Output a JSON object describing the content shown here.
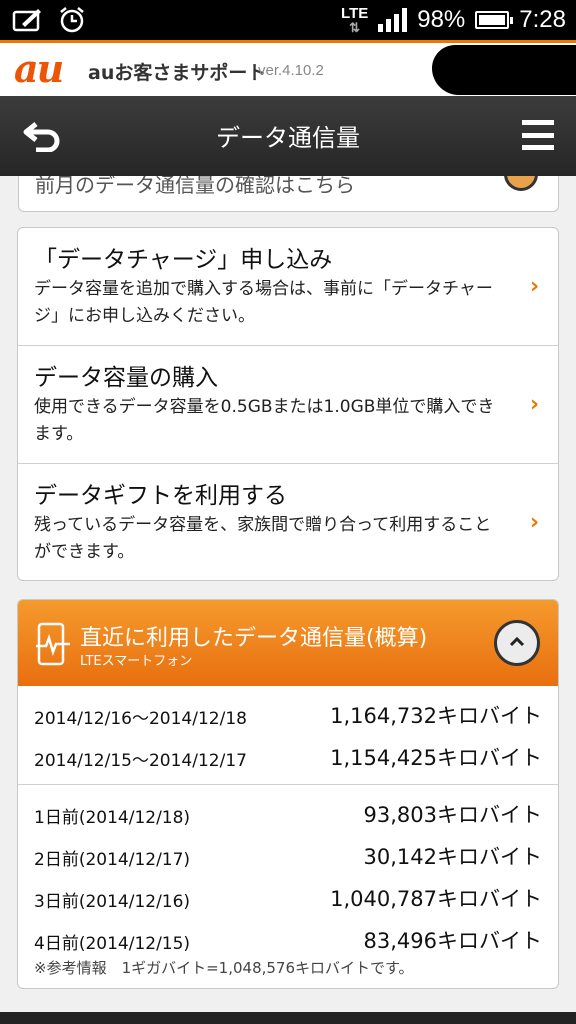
{
  "status_bar": {
    "network": "LTE",
    "battery": "98%",
    "time": "7:28"
  },
  "header": {
    "logo": "au",
    "app_name": "auお客さまサポート",
    "version": "ver.4.10.2"
  },
  "titlebar": {
    "title": "データ通信量"
  },
  "prev_card": {
    "text": "前月のデータ通信量の確認はこちら"
  },
  "menu": {
    "items": [
      {
        "title": "「データチャージ」申し込み",
        "desc": "データ容量を追加で購入する場合は、事前に「データチャージ」にお申し込みください。"
      },
      {
        "title": "データ容量の購入",
        "desc": "使用できるデータ容量を0.5GBまたは1.0GB単位で購入できます。"
      },
      {
        "title": "データギフトを利用する",
        "desc": "残っているデータ容量を、家族間で贈り合って利用することができます。"
      }
    ]
  },
  "usage": {
    "title": "直近に利用したデータ通信量(概算)",
    "subtitle": "LTEスマートフォン",
    "period_rows": [
      {
        "label": "2014/12/16〜2014/12/18",
        "value": "1,164,732キロバイト"
      },
      {
        "label": "2014/12/15〜2014/12/17",
        "value": "1,154,425キロバイト"
      }
    ],
    "daily_rows": [
      {
        "label": "1日前(2014/12/18)",
        "value": "93,803キロバイト"
      },
      {
        "label": "2日前(2014/12/17)",
        "value": "30,142キロバイト"
      },
      {
        "label": "3日前(2014/12/16)",
        "value": "1,040,787キロバイト"
      },
      {
        "label": "4日前(2014/12/15)",
        "value": "83,496キロバイト"
      }
    ],
    "note": "※参考情報　1ギガバイト=1,048,576キロバイトです。"
  },
  "colors": {
    "accent": "#ee7700",
    "brand": "#eb5505"
  }
}
